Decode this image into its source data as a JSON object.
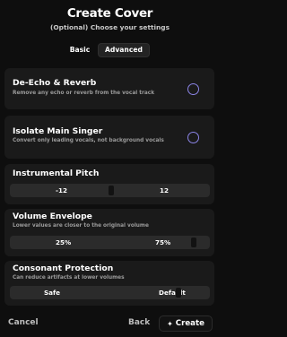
{
  "header": {
    "title": "Create Cover",
    "subtitle": "(Optional) Choose your settings"
  },
  "tabs": [
    {
      "label": "Basic",
      "selected": false
    },
    {
      "label": "Advanced",
      "selected": true
    }
  ],
  "options": [
    {
      "title": "De-Echo & Reverb",
      "description": "Remove any echo or reverb from the vocal track",
      "checked": false
    },
    {
      "title": "Isolate Main Singer",
      "description": "Convert only leading vocals, not background vocals",
      "checked": false
    }
  ],
  "pitch": {
    "title": "Instrumental Pitch",
    "min_label": "-12",
    "max_label": "12",
    "value": 0
  },
  "volume": {
    "title": "Volume Envelope",
    "description": "Lower values are closer to the original volume",
    "min_label": "25%",
    "max_label": "75%",
    "value_fraction": 1.0
  },
  "consonant": {
    "title": "Consonant Protection",
    "description": "Can reduce artifacts at lower volumes",
    "min_label": "Safe",
    "max_label": "Default",
    "value_fraction": 0.9
  },
  "footer": {
    "cancel": "Cancel",
    "back": "Back",
    "create": "Create",
    "create_icon": "sparkle-icon"
  },
  "colors": {
    "background": "#0e0e0e",
    "card": "#1a1a1a",
    "radio_accent": "#8b84e6"
  }
}
